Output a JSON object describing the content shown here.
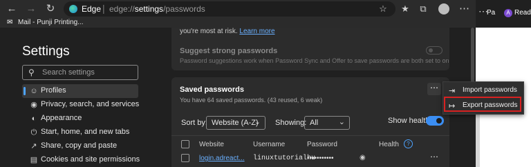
{
  "browser": {
    "app_name": "Edge",
    "url_prefix": "edge://",
    "url_bold": "settings",
    "url_suffix": "/passwords",
    "favorite": "Mail - Punji Printing...",
    "strip_tab1": "Pa",
    "strip_tab2": "Ready to I"
  },
  "sidebar": {
    "title": "Settings",
    "search_placeholder": "Search settings",
    "items": [
      {
        "label": "Profiles",
        "icon": "person-icon"
      },
      {
        "label": "Privacy, search, and services",
        "icon": "lock-icon"
      },
      {
        "label": "Appearance",
        "icon": "palette-icon"
      },
      {
        "label": "Start, home, and new tabs",
        "icon": "power-icon"
      },
      {
        "label": "Share, copy and paste",
        "icon": "share-icon"
      },
      {
        "label": "Cookies and site permissions",
        "icon": "cookie-icon"
      }
    ]
  },
  "top_card": {
    "cut_text": "you're most at risk. ",
    "cut_link": "Learn more",
    "suggest_title": "Suggest strong passwords",
    "suggest_desc": "Password suggestions work when Password Sync and Offer to save passwords are both set to on"
  },
  "saved": {
    "title": "Saved passwords",
    "count": "You have 64 saved passwords. (43 reused, 6 weak)",
    "sort_label": "Sort by:",
    "sort_value": "Website (A-Z)",
    "showing_label": "Showing:",
    "showing_value": "All",
    "health_label": "Show health",
    "columns": [
      "Website",
      "Username",
      "Password",
      "Health"
    ],
    "row": {
      "website": "login.adreact...",
      "username": "linuxtutorialhu",
      "password": "•••••••••••"
    }
  },
  "menu": {
    "import": "Import passwords",
    "export": "Export passwords"
  },
  "colors": {
    "accent": "#3b8ef3",
    "highlight": "#d82121",
    "background": "#202020"
  }
}
